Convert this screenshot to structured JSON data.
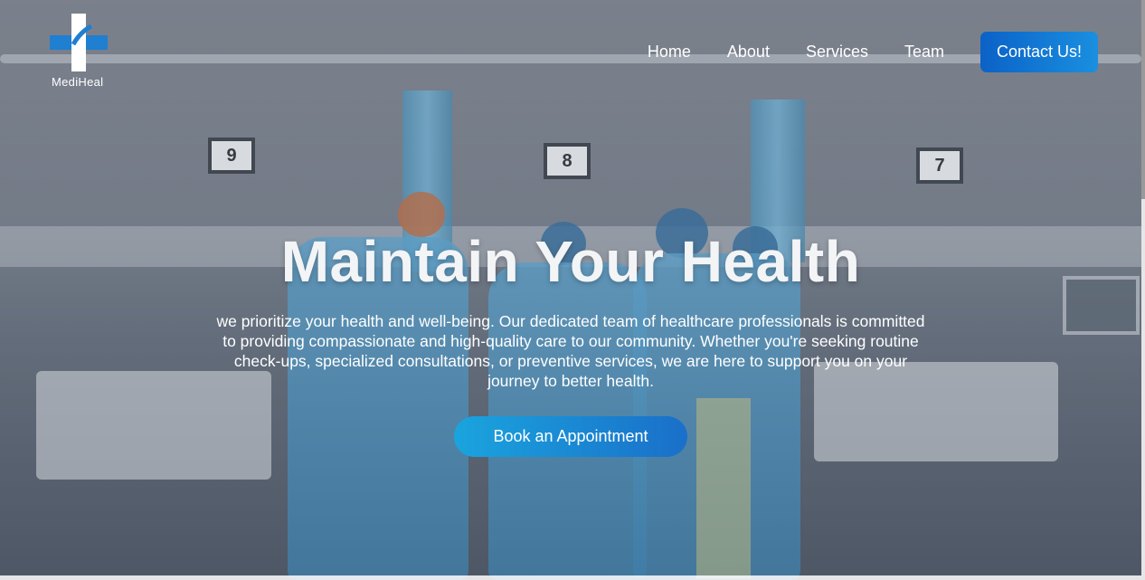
{
  "brand": {
    "name": "MediHeal",
    "logo_icon": "medical-cross-icon"
  },
  "nav": {
    "items": [
      {
        "label": "Home"
      },
      {
        "label": "About"
      },
      {
        "label": "Services"
      },
      {
        "label": "Team"
      }
    ],
    "contact_label": "Contact Us!"
  },
  "hero": {
    "title": "Maintain Your Health",
    "description": "we prioritize your health and well-being. Our dedicated team of healthcare professionals is committed to providing compassionate and high-quality care to our community. Whether you're seeking routine check-ups, specialized consultations, or preventive services, we are here to support you on your journey to better health.",
    "cta_label": "Book an Appointment",
    "bed_numbers": [
      "9",
      "8",
      "7"
    ]
  },
  "colors": {
    "accent": "#1a8fe0",
    "accent_dark": "#0b62c7",
    "overlay": "#3d4656"
  }
}
